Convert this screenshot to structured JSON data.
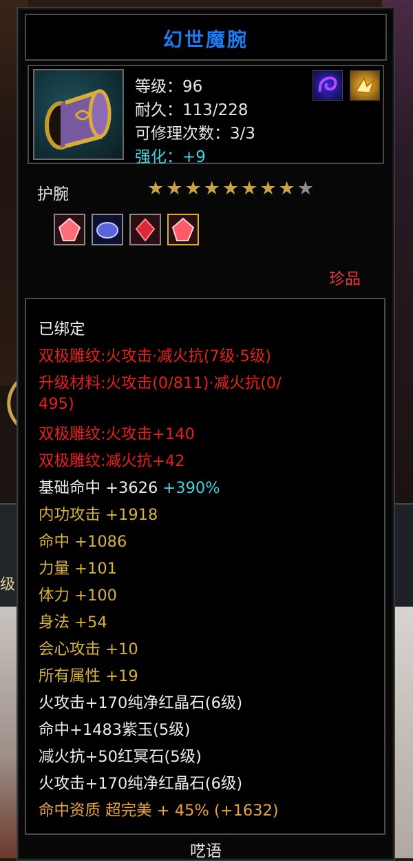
{
  "title": "幻世魔腕",
  "item": {
    "level_label": "等级：",
    "level": "96",
    "durability_label": "耐久：",
    "durability": "113/228",
    "repair_label": "可修理次数：",
    "repair": "3/3",
    "enhance_label": "强化：",
    "enhance": "+9"
  },
  "badges": [
    "blue-spiral-icon",
    "gold-phoenix-icon"
  ],
  "slot_type": "护腕",
  "stars": {
    "filled": 8,
    "total": 9
  },
  "gems": [
    "red-crystal-gem-icon",
    "blue-gem-icon",
    "red-gem-icon",
    "red-crystal-gem-icon"
  ],
  "rarity": "珍品",
  "bound": "已绑定",
  "attributes": {
    "line1": "双极雕纹:火攻击·减火抗(7级·5级)",
    "line2a": "升级材料:火攻击(0/811)·减火抗(0/",
    "line2b": "495)",
    "line3": "双极雕纹:火攻击+140",
    "line4": "双极雕纹:减火抗+42",
    "line5_main": "基础命中 +3626",
    "line5_extra": "+390%",
    "line6": "内功攻击 +1918",
    "line7": "命中 +1086",
    "line8": "力量 +101",
    "line9": "体力 +100",
    "line10": "身法 +54",
    "line11": "会心攻击 +10",
    "line12": "所有属性 +19",
    "line13": "火攻击+170纯净红晶石(6级)",
    "line14": "命中+1483紫玉(5级)",
    "line15": "减火抗+50红冥石(5级)",
    "line16": "火攻击+170纯净红晶石(6级)",
    "line17": "命中资质 超完美 + 45% (+1632)"
  },
  "footer": "呓语",
  "side_label": "级",
  "colors": {
    "title": "#1f7cf0",
    "red": "#e8201c",
    "yellow": "#d6b23e",
    "cyan": "#3fd3e0",
    "orange": "#e8a33c"
  }
}
